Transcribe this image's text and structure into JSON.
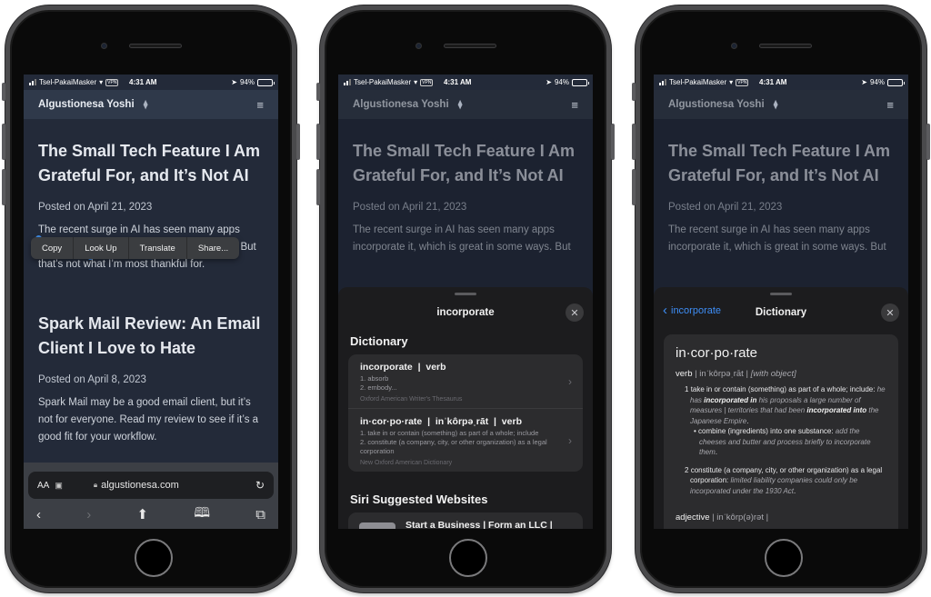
{
  "status_bar": {
    "carrier": "Tsel-PakaiMasker",
    "vpn": "VPN",
    "time": "4:31 AM",
    "battery": "94%",
    "battery_level": 0.94
  },
  "site": {
    "name": "Algustionesa Yoshi",
    "rss_icon": "rss-icon",
    "menu_icon": "hamburger-menu-icon"
  },
  "posts": [
    {
      "title": "The Small Tech Feature I Am Grateful For, and It’s Not AI",
      "date": "Posted on April 21, 2023",
      "excerpt_before": "The recent surge in AI has seen many apps",
      "selected_word": "incorporate",
      "excerpt_after": " it, which is great in some ways. But that’s not what I’m most thankful for.",
      "excerpt_full_line2": "incorporate it, which is great in some ways. But"
    },
    {
      "title": "Spark Mail Review: An Email Client I Love to Hate",
      "date": "Posted on April 8, 2023",
      "excerpt": "Spark Mail may be a good email client, but it’s not for everyone. Read my review to see if it’s a good fit for your workflow."
    }
  ],
  "edit_menu": {
    "items": [
      "Copy",
      "Look Up",
      "Translate",
      "Share..."
    ]
  },
  "safari": {
    "text_size_label": "AA",
    "url": "algustionesa.com",
    "toolbar": [
      "back",
      "forward",
      "share",
      "bookmarks",
      "tabs"
    ]
  },
  "lookup_sheet": {
    "title": "incorporate",
    "dictionary_heading": "Dictionary",
    "entries": [
      {
        "headword": "incorporate  |  verb",
        "definitions": [
          "1. absorb",
          "2. embody..."
        ],
        "source": "Oxford American Writer's Thesaurus"
      },
      {
        "headword": "in·cor·po·rate  |  inˈkôrpəˌrāt  |  verb",
        "definitions": [
          "1. take in or contain (something) as part of a whole; include",
          "2. constitute (a company, city, or other organization) as a legal corporation"
        ],
        "source": "New Oxford American Dictionary"
      }
    ],
    "siri_heading": "Siri Suggested Websites",
    "siri_sites": [
      {
        "title": "Start a Business | Form an LLC |"
      }
    ]
  },
  "dictionary_view": {
    "back_label": "incorporate",
    "title": "Dictionary",
    "word": "in·cor·po·rate",
    "verb": {
      "pos": "verb",
      "pron": " | inˈkôrpəˌrāt | ",
      "grammar": "[with object]",
      "senses": [
        {
          "num": "1",
          "text": "take in or contain (something) as part of a whole; include: ",
          "example_parts": [
            {
              "t": "he has ",
              "b": false
            },
            {
              "t": "incorporated in",
              "b": true
            },
            {
              "t": " his proposals a large number of measures | territories that had been ",
              "b": false
            },
            {
              "t": "incorporated into",
              "b": true
            },
            {
              "t": " the Japanese Empire",
              "b": false
            }
          ],
          "subsense": {
            "text": "combine (ingredients) into one substance: ",
            "example": "add the cheeses and butter and process briefly to incorporate them"
          }
        },
        {
          "num": "2",
          "text": "constitute (a company, city, or other organization) as a legal corporation: ",
          "example": "limited liability companies could only be incorporated under the 1930 Act"
        }
      ]
    },
    "adjective": {
      "pos": "adjective",
      "pron": " | inˈkôrp(ə)rət |"
    }
  }
}
